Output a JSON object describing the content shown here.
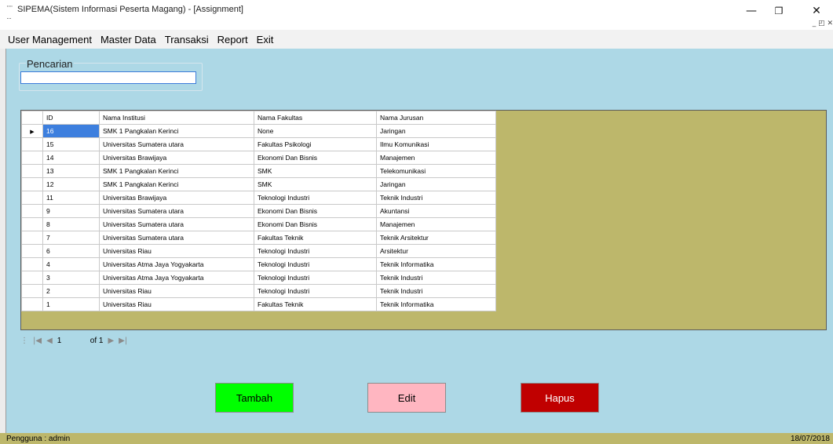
{
  "window": {
    "title": "SIPEMA(Sistem Informasi Peserta Magang) - [Assignment]",
    "minimize": "—",
    "restore": "❐",
    "close": "✕",
    "mdi_controls": "_ ◰ ✕"
  },
  "menu": [
    "User Management",
    "Master Data",
    "Transaksi",
    "Report",
    "Exit"
  ],
  "search": {
    "label": "Pencarian",
    "value": ""
  },
  "grid": {
    "columns": [
      "ID",
      "Nama Institusi",
      "Nama Fakultas",
      "Nama Jurusan"
    ],
    "row_indicator": "▶",
    "rows": [
      [
        "16",
        "SMK 1 Pangkalan Kerinci",
        "None",
        "Jaringan"
      ],
      [
        "15",
        "Universitas Sumatera utara",
        "Fakultas Psikologi",
        "Ilmu Komunikasi"
      ],
      [
        "14",
        "Universitas Brawijaya",
        "Ekonomi Dan Bisnis",
        "Manajemen"
      ],
      [
        "13",
        "SMK 1 Pangkalan Kerinci",
        "SMK",
        "Telekomunikasi"
      ],
      [
        "12",
        "SMK 1 Pangkalan Kerinci",
        "SMK",
        "Jaringan"
      ],
      [
        "11",
        "Universitas Brawijaya",
        "Teknologi Industri",
        "Teknik Industri"
      ],
      [
        "9",
        "Universitas Sumatera utara",
        "Ekonomi Dan Bisnis",
        "Akuntansi"
      ],
      [
        "8",
        "Universitas Sumatera utara",
        "Ekonomi Dan Bisnis",
        "Manajemen"
      ],
      [
        "7",
        "Universitas Sumatera utara",
        "Fakultas Teknik",
        "Teknik Arsitektur"
      ],
      [
        "6",
        "Universitas Riau",
        "Teknologi Industri",
        "Arsitektur"
      ],
      [
        "4",
        "Universitas Atma Jaya Yogyakarta",
        "Teknologi Industri",
        "Teknik Informatika"
      ],
      [
        "3",
        "Universitas Atma Jaya Yogyakarta",
        "Teknologi Industri",
        "Teknik Industri"
      ],
      [
        "2",
        "Universitas Riau",
        "Teknologi Industri",
        "Teknik Industri"
      ],
      [
        "1",
        "Universitas Riau",
        "Fakultas Teknik",
        "Teknik Informatika"
      ]
    ]
  },
  "navigator": {
    "grip": "⋮",
    "first": "|◀",
    "prev": "◀",
    "position": "1",
    "of": "of 1",
    "next": "▶",
    "last": "▶|"
  },
  "buttons": {
    "tambah": "Tambah",
    "edit": "Edit",
    "hapus": "Hapus"
  },
  "status": {
    "user": "Pengguna : admin",
    "date": "18/07/2018"
  },
  "colors": {
    "client_bg": "#add8e6",
    "grid_bg": "#bdb76b",
    "status_bg": "#bdb76b",
    "selection": "#3d7fde",
    "tambah": "#00ff00",
    "edit": "#ffb6c1",
    "hapus": "#c00000"
  }
}
